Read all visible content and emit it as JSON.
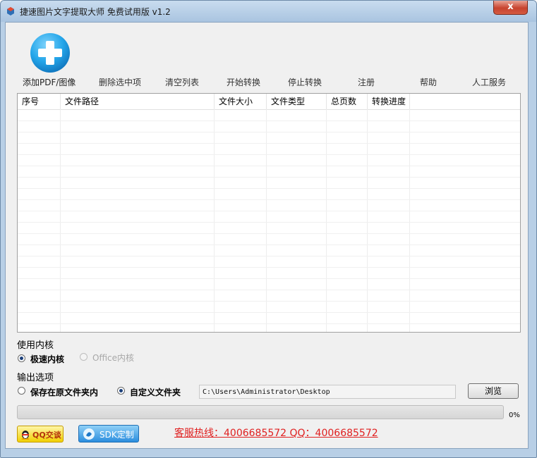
{
  "window": {
    "title": "捷速图片文字提取大师 免费试用版 v1.2",
    "close_label": "x"
  },
  "toolbar": {
    "add": "添加PDF/图像",
    "delete": "删除选中项",
    "clear": "清空列表",
    "start": "开始转换",
    "stop": "停止转换",
    "register": "注册",
    "help": "帮助",
    "service": "人工服务"
  },
  "table": {
    "columns": [
      "序号",
      "文件路径",
      "文件大小",
      "文件类型",
      "总页数",
      "转换进度"
    ],
    "rows": []
  },
  "engine": {
    "section_title": "使用内核",
    "options": [
      {
        "label": "极速内核",
        "selected": true,
        "enabled": true
      },
      {
        "label": "Office内核",
        "selected": false,
        "enabled": false
      }
    ]
  },
  "output": {
    "section_title": "输出选项",
    "options": [
      {
        "label": "保存在原文件夹内",
        "selected": false
      },
      {
        "label": "自定义文件夹",
        "selected": true
      }
    ],
    "path_value": "C:\\Users\\Administrator\\Desktop",
    "browse_label": "浏览"
  },
  "progress": {
    "value": 0,
    "label": "0%"
  },
  "footer": {
    "qq_label": "QQ交谈",
    "sdk_label": "SDK定制",
    "hotline": "客服热线：4006685572 QQ：4006685572"
  },
  "colors": {
    "accent_blue": "#2c8ede",
    "hotline_red": "#e02020",
    "qq_yellow": "#f1d000"
  }
}
